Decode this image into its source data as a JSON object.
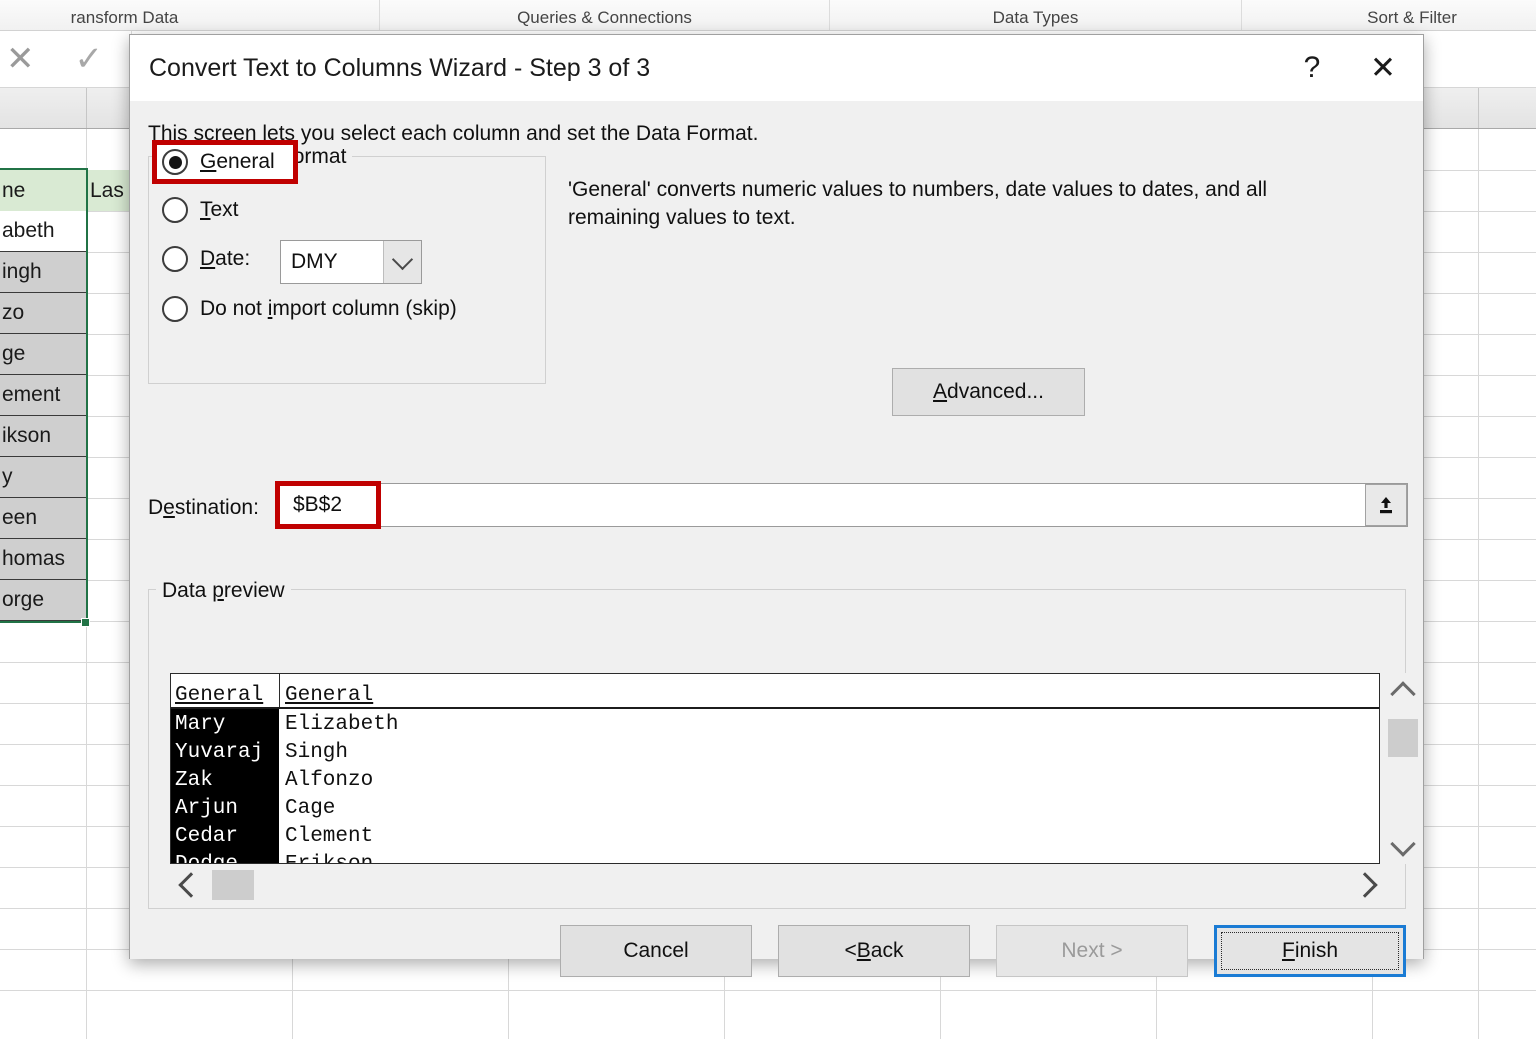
{
  "excel": {
    "ribbon_groups": [
      "ransform Data",
      "Queries & Connections",
      "Data Types",
      "Sort & Filter"
    ],
    "formula_bar": {
      "cancel_icon": "x-icon",
      "confirm_icon": "check-icon"
    },
    "columns": [
      {
        "header": "ne",
        "cells": [
          "abeth",
          "ingh",
          "zo",
          "ge",
          "ement",
          "ikson",
          "y",
          "een",
          "homas",
          "orge"
        ]
      },
      {
        "header": "Las",
        "cells": [
          "",
          "",
          "",
          "",
          "",
          "",
          "",
          "",
          "",
          ""
        ]
      }
    ]
  },
  "dialog": {
    "title": "Convert Text to Columns Wizard - Step 3 of 3",
    "help_icon": "question-mark-icon",
    "close_icon": "close-icon",
    "intro": "This screen lets you select each column and set the Data Format.",
    "column_data_format": {
      "legend": "Column data format",
      "options": [
        {
          "label_pre": "",
          "accel": "G",
          "label_post": "eneral",
          "checked": true
        },
        {
          "label_pre": "",
          "accel": "T",
          "label_post": "ext",
          "checked": false
        },
        {
          "label_pre": "",
          "accel": "D",
          "label_post": "ate:",
          "checked": false
        },
        {
          "label_pre": "Do not ",
          "accel": "i",
          "label_post": "mport column (skip)",
          "checked": false
        }
      ],
      "date_format_value": "DMY",
      "date_format_arrow": "chevron-down-icon"
    },
    "description": "'General' converts numeric values to numbers, date values to dates, and all remaining values to text.",
    "advanced_button": {
      "pre": "",
      "accel": "A",
      "post": "dvanced..."
    },
    "destination": {
      "label_pre": "D",
      "label_accel": "e",
      "label_post": "stination:",
      "value": "$B$2",
      "collapse_icon": "collapse-dialog-icon"
    },
    "data_preview": {
      "legend_pre": "Data ",
      "legend_accel": "p",
      "legend_post": "review",
      "headers": [
        "General",
        "General"
      ],
      "rows": [
        [
          "Mary",
          "Elizabeth"
        ],
        [
          "Yuvaraj",
          "Singh"
        ],
        [
          "Zak",
          "Alfonzo"
        ],
        [
          "Arjun",
          "Cage"
        ],
        [
          "Cedar",
          "Clement"
        ],
        [
          "Dodge",
          "Erikson"
        ]
      ],
      "selected_column_index": 0,
      "vscroll": {
        "up_icon": "chevron-up-icon",
        "down_icon": "chevron-down-icon"
      },
      "hscroll": {
        "left_icon": "chevron-left-icon",
        "right_icon": "chevron-right-icon"
      }
    },
    "buttons": [
      {
        "name": "cancel",
        "pre": "Cancel",
        "accel": "",
        "post": "",
        "state": "normal"
      },
      {
        "name": "back",
        "pre": "< ",
        "accel": "B",
        "post": "ack",
        "state": "normal"
      },
      {
        "name": "next",
        "pre": "Next >",
        "accel": "",
        "post": "",
        "state": "disabled"
      },
      {
        "name": "finish",
        "pre": "",
        "accel": "F",
        "post": "inish",
        "state": "default"
      }
    ]
  },
  "colors": {
    "highlight_red": "#c00000",
    "focus_blue": "#1a7bd4",
    "excel_green": "#217346",
    "header_green": "#d9ead3"
  }
}
